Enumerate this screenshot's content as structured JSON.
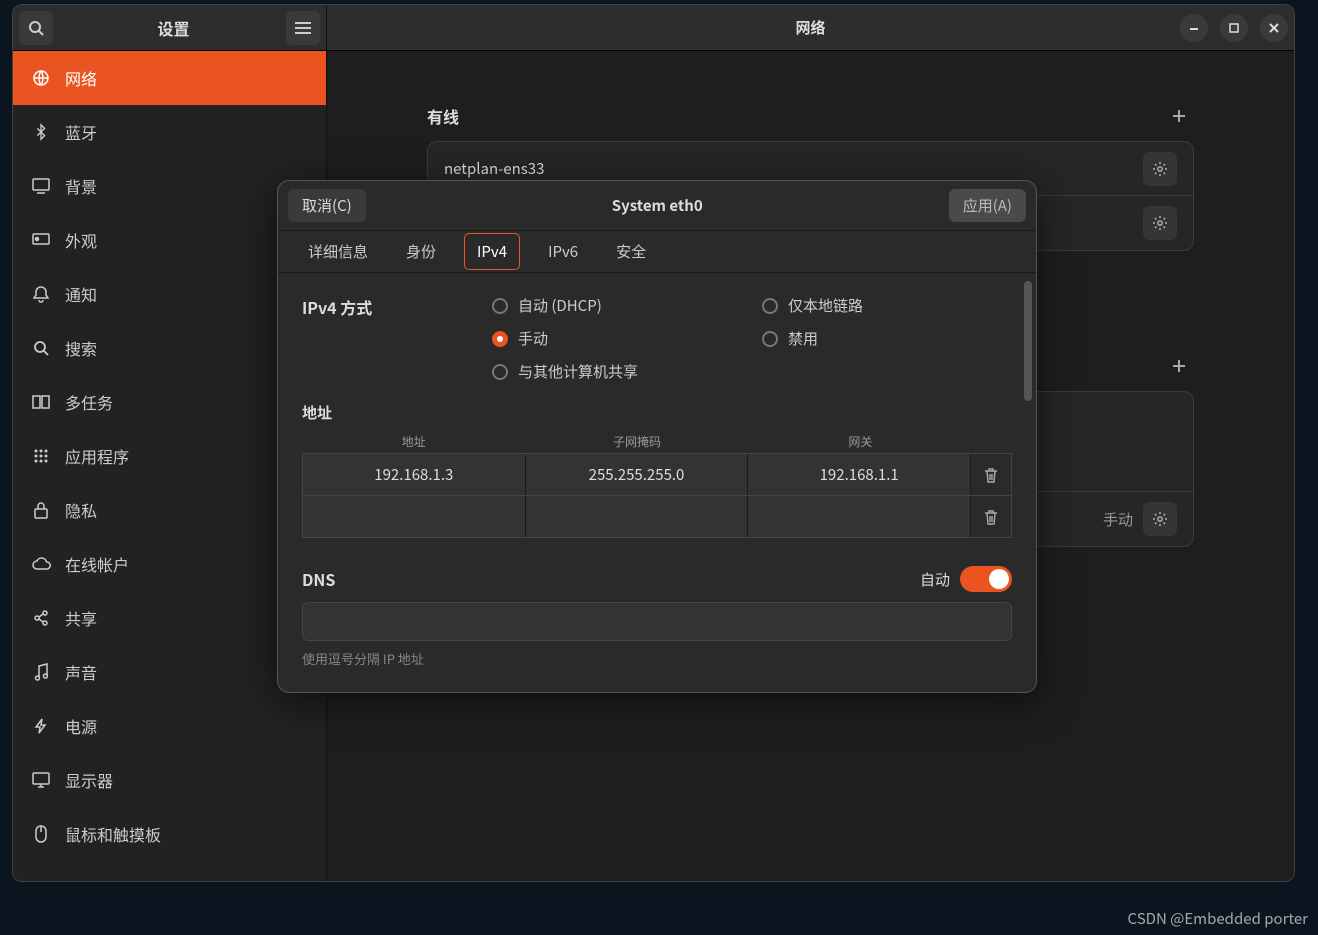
{
  "header": {
    "sidebar_title": "设置",
    "main_title": "网络"
  },
  "sidebar": {
    "items": [
      {
        "icon": "globe",
        "label": "网络",
        "active": true
      },
      {
        "icon": "bluetooth",
        "label": "蓝牙"
      },
      {
        "icon": "desktop",
        "label": "背景"
      },
      {
        "icon": "appearance",
        "label": "外观"
      },
      {
        "icon": "bell",
        "label": "通知"
      },
      {
        "icon": "search",
        "label": "搜索"
      },
      {
        "icon": "multitask",
        "label": "多任务"
      },
      {
        "icon": "apps",
        "label": "应用程序"
      },
      {
        "icon": "lock",
        "label": "隐私"
      },
      {
        "icon": "cloud",
        "label": "在线帐户"
      },
      {
        "icon": "share",
        "label": "共享"
      },
      {
        "icon": "music",
        "label": "声音"
      },
      {
        "icon": "power",
        "label": "电源"
      },
      {
        "icon": "display",
        "label": "显示器"
      },
      {
        "icon": "mouse",
        "label": "鼠标和触摸板"
      }
    ]
  },
  "main": {
    "wired_label": "有线",
    "conn1": "netplan-ens33",
    "vpn_manual_tag": "手动"
  },
  "dialog": {
    "cancel": "取消(C)",
    "apply": "应用(A)",
    "title": "System eth0",
    "tabs": [
      "详细信息",
      "身份",
      "IPv4",
      "IPv6",
      "安全"
    ],
    "active_tab": 2,
    "method_label": "IPv4 方式",
    "methods": [
      {
        "label": "自动 (DHCP)",
        "checked": false
      },
      {
        "label": "仅本地链路",
        "checked": false
      },
      {
        "label": "手动",
        "checked": true
      },
      {
        "label": "禁用",
        "checked": false
      },
      {
        "label": "与其他计算机共享",
        "checked": false
      }
    ],
    "addr_label": "地址",
    "addr_headers": [
      "地址",
      "子网掩码",
      "网关"
    ],
    "addr_rows": [
      {
        "address": "192.168.1.3",
        "mask": "255.255.255.0",
        "gateway": "192.168.1.1"
      },
      {
        "address": "",
        "mask": "",
        "gateway": ""
      }
    ],
    "dns_label": "DNS",
    "dns_auto_label": "自动",
    "dns_value": "",
    "dns_hint": "使用逗号分隔 IP 地址"
  },
  "watermark": "CSDN @Embedded porter"
}
